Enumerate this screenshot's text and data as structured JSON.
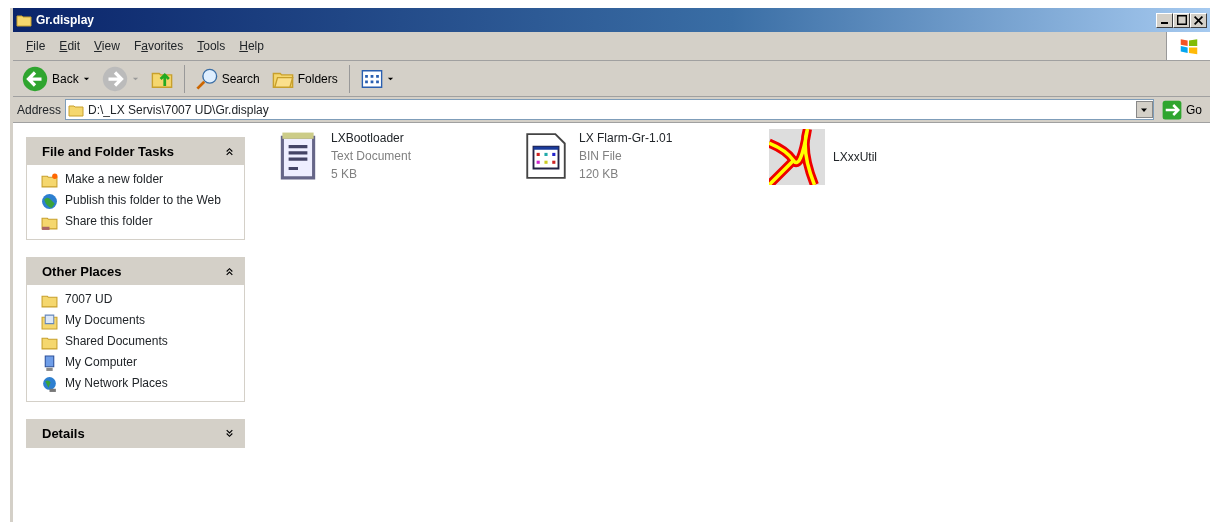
{
  "window": {
    "title": "Gr.display"
  },
  "menu": [
    {
      "accel": "F",
      "after": "ile"
    },
    {
      "accel": "E",
      "after": "dit"
    },
    {
      "accel": "V",
      "after": "iew"
    },
    {
      "before": "F",
      "accel": "a",
      "after": "vorites"
    },
    {
      "accel": "T",
      "after": "ools"
    },
    {
      "accel": "H",
      "after": "elp"
    }
  ],
  "toolbar": [
    {
      "kind": "back",
      "label": "Back",
      "disabled": false
    },
    {
      "kind": "forward",
      "disabled": true
    },
    {
      "kind": "up"
    },
    {
      "kind": "search",
      "label": "Search"
    },
    {
      "kind": "folders",
      "label": "Folders"
    },
    {
      "kind": "views"
    }
  ],
  "address": {
    "label": "Address",
    "value": "D:\\_LX Servis\\7007 UD\\Gr.display",
    "go": "Go"
  },
  "panels": [
    {
      "title": "File and Folder Tasks",
      "expanded": true,
      "items": [
        {
          "kind": "newfolder",
          "label": "Make a new folder"
        },
        {
          "kind": "publish",
          "label": "Publish this folder to the Web"
        },
        {
          "kind": "share",
          "label": "Share this folder"
        }
      ]
    },
    {
      "title": "Other Places",
      "expanded": true,
      "items": [
        {
          "kind": "folder",
          "label": "7007 UD"
        },
        {
          "kind": "documents",
          "label": "My Documents"
        },
        {
          "kind": "folder",
          "label": "Shared Documents"
        },
        {
          "kind": "computer",
          "label": "My Computer"
        },
        {
          "kind": "network",
          "label": "My Network Places"
        }
      ]
    },
    {
      "title": "Details",
      "expanded": false
    }
  ],
  "files": [
    {
      "kind": "text",
      "name": "LXBootloader",
      "type": "Text Document",
      "size": "5 KB"
    },
    {
      "kind": "bin",
      "name": "LX Flarm-Gr-1.01",
      "type": "BIN File",
      "size": "120 KB"
    },
    {
      "kind": "image",
      "name": "LXxxUtil"
    }
  ]
}
